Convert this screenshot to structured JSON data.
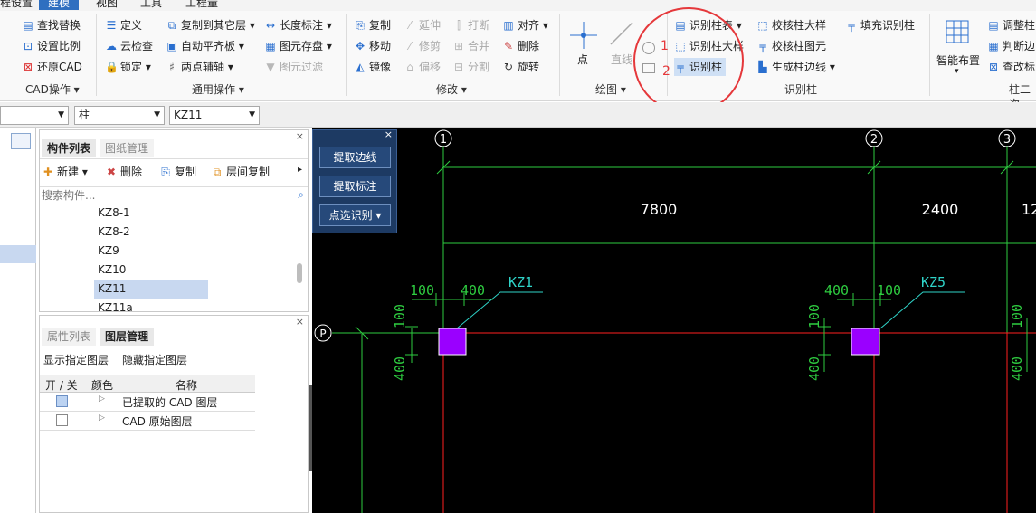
{
  "menubar": {
    "items": [
      "程设置",
      "建模",
      "视图",
      "工具",
      "工程量"
    ],
    "active_index": 1
  },
  "ribbon": {
    "cad_group": {
      "label": "CAD操作 ▾",
      "items": [
        "查找替换",
        "设置比例",
        "还原CAD"
      ]
    },
    "general_group": {
      "label": "通用操作 ▾",
      "items": [
        "定义",
        "云检查",
        "锁定 ▾",
        "复制到其它层 ▾",
        "自动平齐板 ▾",
        "两点辅轴 ▾",
        "长度标注 ▾",
        "图元存盘 ▾",
        "图元过滤"
      ]
    },
    "modify_group": {
      "label": "修改 ▾",
      "items": [
        "复制",
        "移动",
        "镜像",
        "延伸",
        "修剪",
        "偏移",
        "打断",
        "合并",
        "分割",
        "对齐 ▾",
        "删除",
        "旋转"
      ]
    },
    "draw_group": {
      "label": "绘图 ▾",
      "items": [
        "点",
        "直线"
      ]
    },
    "identify_group": {
      "label": "识别柱",
      "items": [
        "识别柱表 ▾",
        "识别柱大样",
        "识别柱",
        "校核柱大样",
        "校核柱图元",
        "生成柱边线 ▾",
        "填充识别柱"
      ]
    },
    "col2_group": {
      "label": "柱二次",
      "items": [
        "智能布置",
        "调整柱",
        "判断边",
        "查改标"
      ]
    },
    "annotations": {
      "num1": "1",
      "num2": "2"
    }
  },
  "toolbar2": {
    "combo1": "",
    "combo2": "柱",
    "combo3": "KZ11"
  },
  "component_panel": {
    "tabs": [
      "构件列表",
      "图纸管理"
    ],
    "actions": [
      "新建 ▾",
      "删除",
      "复制",
      "层间复制"
    ],
    "search_placeholder": "搜索构件...",
    "items": [
      "KZ8-1",
      "KZ8-2",
      "KZ9",
      "KZ10",
      "KZ11",
      "KZ11a"
    ],
    "selected": "KZ11"
  },
  "layer_panel": {
    "tabs": [
      "属性列表",
      "图层管理"
    ],
    "actions": [
      "显示指定图层",
      "隐藏指定图层"
    ],
    "columns": [
      "开 / 关",
      "颜色",
      "名称"
    ],
    "rows": [
      {
        "name": "已提取的 CAD 图层",
        "checked": true
      },
      {
        "name": "CAD 原始图层",
        "checked": false
      }
    ]
  },
  "float_panel": {
    "buttons": [
      "提取边线",
      "提取标注",
      "点选识别 ▾"
    ]
  },
  "cad": {
    "axes_top": [
      "1",
      "2",
      "3"
    ],
    "axis_left": "P",
    "dimensions_top": [
      "7800",
      "2400",
      "12"
    ],
    "column_labels": [
      "KZ1",
      "KZ5"
    ],
    "dims_kz1": [
      "100",
      "400",
      "100",
      "400"
    ],
    "dims_kz5": [
      "400",
      "100",
      "100",
      "400"
    ]
  },
  "colors": {
    "accent": "#2f6fc0",
    "highlight_circle": "#e5383b",
    "cad_green": "#2ecc40",
    "cad_red": "#ff2020",
    "cad_column": "#9a00ff",
    "cad_cyan": "#2fd3c8"
  }
}
